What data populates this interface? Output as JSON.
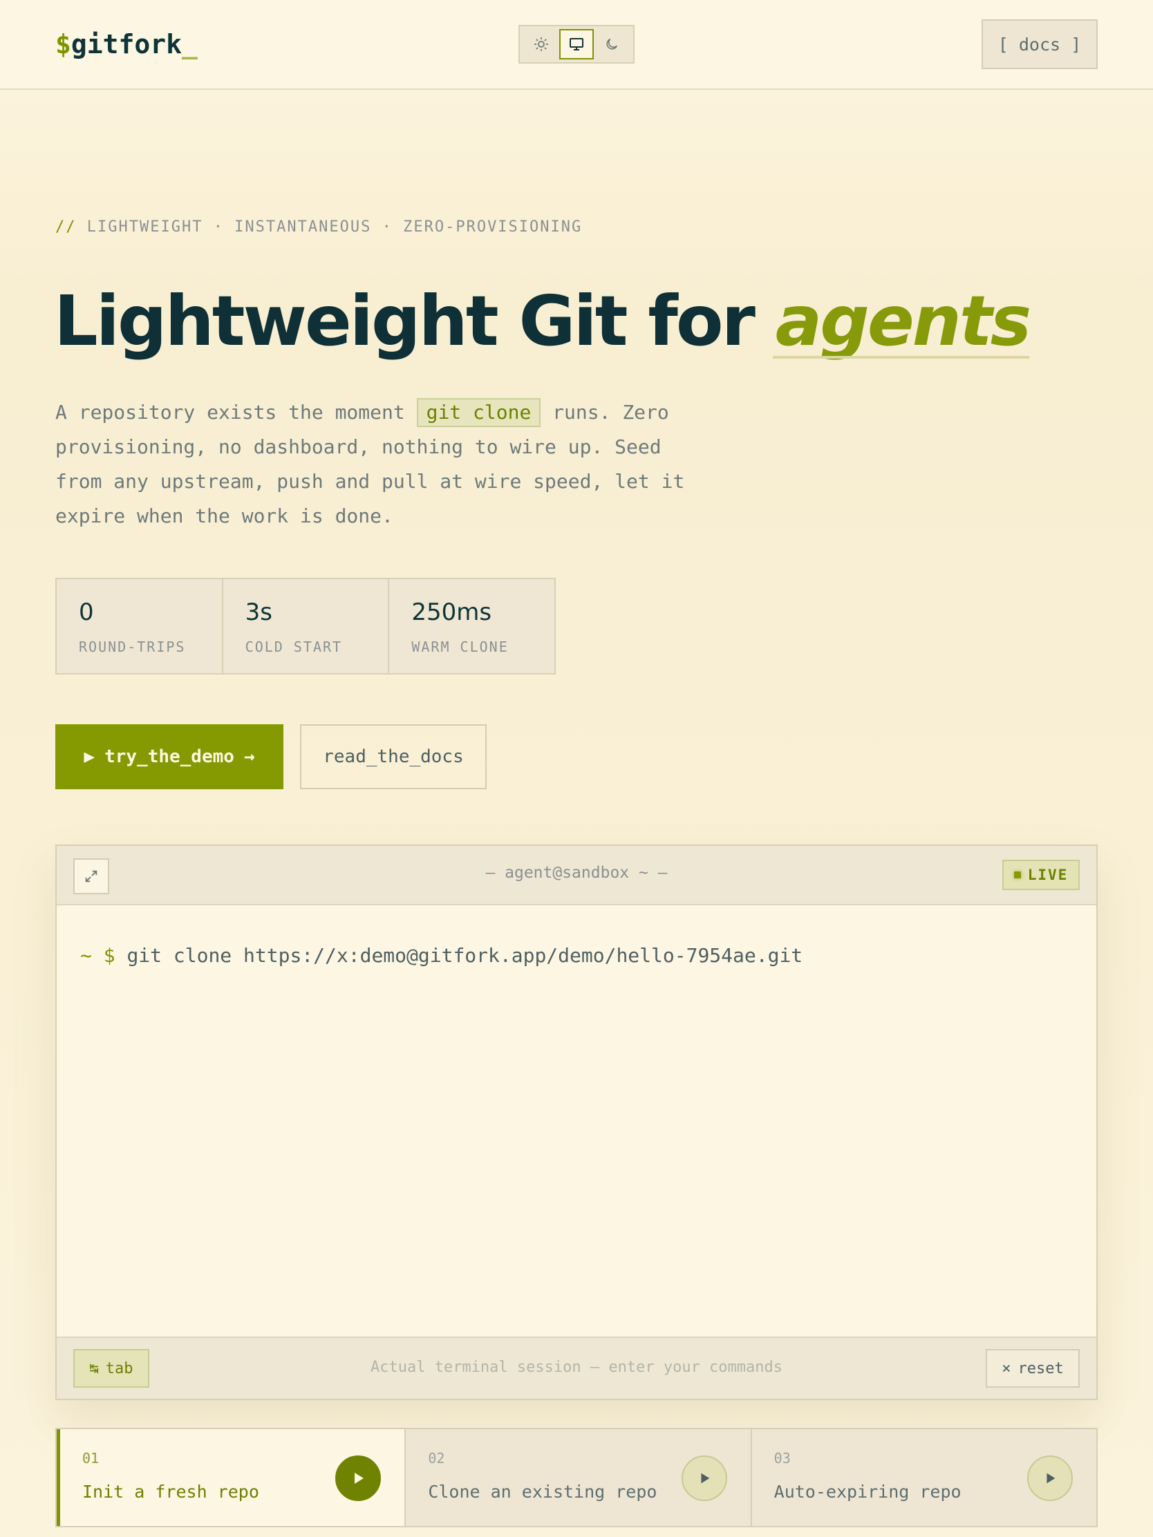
{
  "header": {
    "logo_dollar": "$",
    "logo_text": "gitfork",
    "logo_cursor": "_",
    "theme_options": [
      {
        "icon": "sun-icon",
        "active": false
      },
      {
        "icon": "monitor-icon",
        "active": true
      },
      {
        "icon": "moon-icon",
        "active": false
      }
    ],
    "docs_label": "[ docs ]"
  },
  "hero": {
    "eyebrow_prefix": "//",
    "eyebrow_text": "LIGHTWEIGHT · INSTANTANEOUS · ZERO-PROVISIONING",
    "headline_main": "Lightweight Git for ",
    "headline_accent": "agents",
    "lede_before": "A repository exists the moment ",
    "lede_code": "git clone",
    "lede_after": " runs. Zero provisioning, no dashboard, nothing to wire up. Seed from any upstream, push and pull at wire speed, let it expire when the work is done."
  },
  "stats": [
    {
      "value": "0",
      "label": "ROUND-TRIPS"
    },
    {
      "value": "3s",
      "label": "COLD START"
    },
    {
      "value": "250ms",
      "label": "WARM CLONE"
    }
  ],
  "cta": {
    "primary_icon": "▶",
    "primary_label": "try_the_demo",
    "primary_arrow": "→",
    "secondary_label": "read_the_docs"
  },
  "terminal": {
    "title": "— agent@sandbox  ~ —",
    "live_label": "LIVE",
    "prompt": "~ $",
    "command": "git clone https://x:demo@gitfork.app/demo/hello-7954ae.git",
    "tab_icon": "↹",
    "tab_label": "tab",
    "hint": "Actual terminal session — enter your commands",
    "reset_icon": "×",
    "reset_label": "reset"
  },
  "steps": [
    {
      "num": "01",
      "title": "Init a fresh repo",
      "active": true
    },
    {
      "num": "02",
      "title": "Clone an existing repo",
      "active": false
    },
    {
      "num": "03",
      "title": "Auto-expiring repo",
      "active": false
    }
  ],
  "colors": {
    "accent": "#849a00",
    "ink": "#0f3438",
    "background": "#f9f0d6"
  }
}
